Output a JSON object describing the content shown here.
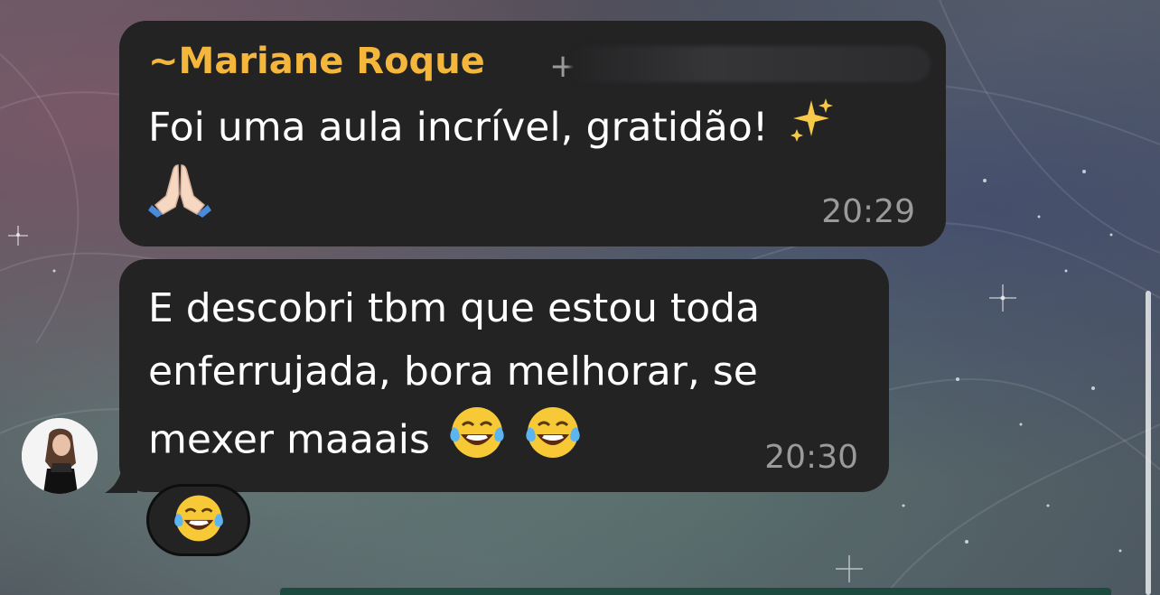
{
  "messages": [
    {
      "sender": "~Mariane Roque",
      "phone": "+",
      "lines": [
        "Foi uma aula incrível, gratidão!",
        ""
      ],
      "emojis": [
        "sparkles",
        "folded-hands"
      ],
      "time": "20:29"
    },
    {
      "lines": [
        "E descobri tbm que estou toda",
        "enferrujada, bora melhorar, se",
        "mexer maaais"
      ],
      "emojis": [
        "tears-of-joy",
        "tears-of-joy"
      ],
      "time": "20:30"
    }
  ],
  "reaction": {
    "emoji": "tears-of-joy"
  },
  "colors": {
    "bubble": "#232324",
    "sender_name": "#f5b73b",
    "timestamp": "#9a9a9a",
    "text": "#ffffff"
  }
}
